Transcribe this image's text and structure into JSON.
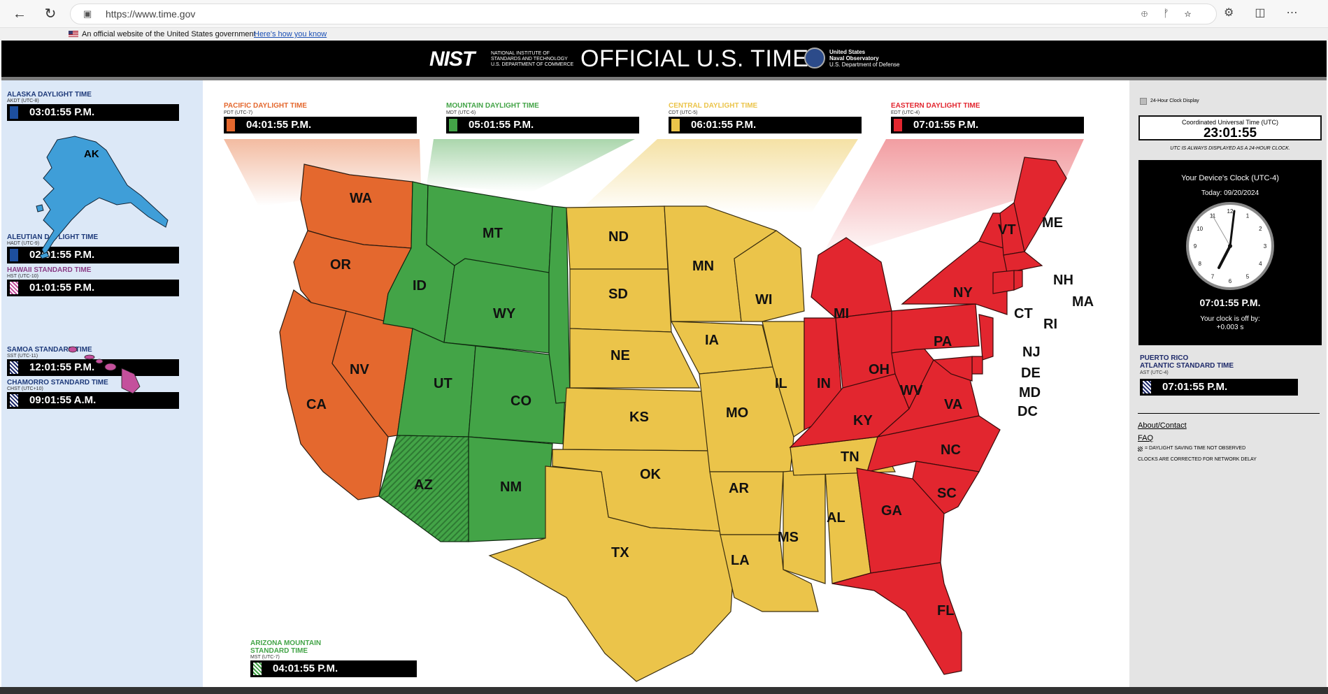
{
  "browser": {
    "url": "https://www.time.gov",
    "back_icon": "arrow-left-icon",
    "reload_icon": "reload-icon",
    "lock_icon": "lock-icon"
  },
  "gov_banner": {
    "text": "An official website of the United States government",
    "link": "Here's how you know"
  },
  "header": {
    "nist": "NIST",
    "nist_sub1": "NATIONAL INSTITUTE OF",
    "nist_sub2": "STANDARDS AND TECHNOLOGY",
    "nist_sub3": "U.S. DEPARTMENT OF COMMERCE",
    "title": "OFFICIAL U.S. TIME",
    "usno1": "United States",
    "usno2": "Naval Observatory",
    "usno3": "U.S. Department of Defense"
  },
  "colors": {
    "pacific": "#e4682e",
    "mountain": "#43a447",
    "central": "#ebc44a",
    "eastern": "#e2262f",
    "alaska": "#3f9ed8",
    "hawaii": "#c4509c"
  },
  "zones_left": [
    {
      "name": "ALASKA DAYLIGHT TIME",
      "sub": "AKDT (UTC-8)",
      "time": "03:01:55 P.M.",
      "color": "#1d4f9e",
      "dst": false
    },
    {
      "name": "ALEUTIAN DAYLIGHT TIME",
      "sub": "HADT (UTC-9)",
      "time": "02:01:55 P.M.",
      "color": "#1d4f9e",
      "dst": false
    },
    {
      "name": "HAWAII STANDARD TIME",
      "sub": "HST (UTC-10)",
      "time": "01:01:55 P.M.",
      "color": "#c4509c",
      "dst": true
    },
    {
      "name": "SAMOA STANDARD TIME",
      "sub": "SST (UTC-11)",
      "time": "12:01:55 P.M.",
      "color": "#1e2a6a",
      "dst": true
    },
    {
      "name": "CHAMORRO STANDARD TIME",
      "sub": "CHST (UTC+10)",
      "time": "09:01:55 A.M.",
      "color": "#1e2a6a",
      "dst": true
    }
  ],
  "zones_top": [
    {
      "name": "PACIFIC DAYLIGHT TIME",
      "sub": "PDT (UTC-7)",
      "time": "04:01:55 P.M.",
      "color": "#e4682e"
    },
    {
      "name": "MOUNTAIN DAYLIGHT TIME",
      "sub": "MDT (UTC-6)",
      "time": "05:01:55 P.M.",
      "color": "#43a447"
    },
    {
      "name": "CENTRAL DAYLIGHT TIME",
      "sub": "CDT (UTC-5)",
      "time": "06:01:55 P.M.",
      "color": "#ebc44a"
    },
    {
      "name": "EASTERN DAYLIGHT TIME",
      "sub": "EDT (UTC-4)",
      "time": "07:01:55 P.M.",
      "color": "#e2262f"
    }
  ],
  "arizona": {
    "name1": "ARIZONA MOUNTAIN",
    "name2": "STANDARD TIME",
    "sub": "MST (UTC-7)",
    "time": "04:01:55 P.M."
  },
  "states": {
    "AK": "AK",
    "HI": "HI",
    "WA": "WA",
    "OR": "OR",
    "CA": "CA",
    "NV": "NV",
    "ID": "ID",
    "MT": "MT",
    "WY": "WY",
    "UT": "UT",
    "CO": "CO",
    "AZ": "AZ",
    "NM": "NM",
    "ND": "ND",
    "SD": "SD",
    "NE": "NE",
    "KS": "KS",
    "OK": "OK",
    "TX": "TX",
    "MN": "MN",
    "IA": "IA",
    "MO": "MO",
    "AR": "AR",
    "LA": "LA",
    "WI": "WI",
    "IL": "IL",
    "MS": "MS",
    "AL": "AL",
    "TN": "TN",
    "MI": "MI",
    "IN": "IN",
    "OH": "OH",
    "KY": "KY",
    "WV": "WV",
    "VA": "VA",
    "PA": "PA",
    "NY": "NY",
    "VT": "VT",
    "ME": "ME",
    "NH": "NH",
    "MA": "MA",
    "CT": "CT",
    "RI": "RI",
    "NJ": "NJ",
    "DE": "DE",
    "MD": "MD",
    "DC": "DC",
    "NC": "NC",
    "SC": "SC",
    "GA": "GA",
    "FL": "FL"
  },
  "right": {
    "toggle": "24-Hour Clock Display",
    "utc_label": "Coordinated Universal Time (UTC)",
    "utc_time": "23:01:55",
    "utc_note": "UTC IS ALWAYS DISPLAYED AS A 24-HOUR CLOCK.",
    "device_title": "Your Device's Clock (UTC-4)",
    "today": "Today: 09/20/2024",
    "device_time": "07:01:55 P.M.",
    "offset_label": "Your clock is off by:",
    "offset": "+0.003 s",
    "pr1": "PUERTO RICO",
    "pr2": "ATLANTIC STANDARD TIME",
    "pr_sub": "AST (UTC-4)",
    "pr_time": "07:01:55 P.M.",
    "about": "About/Contact",
    "faq": "FAQ",
    "dst_note": "= DAYLIGHT SAVING TIME NOT OBSERVED",
    "network_note": "CLOCKS ARE CORRECTED FOR NETWORK DELAY"
  }
}
